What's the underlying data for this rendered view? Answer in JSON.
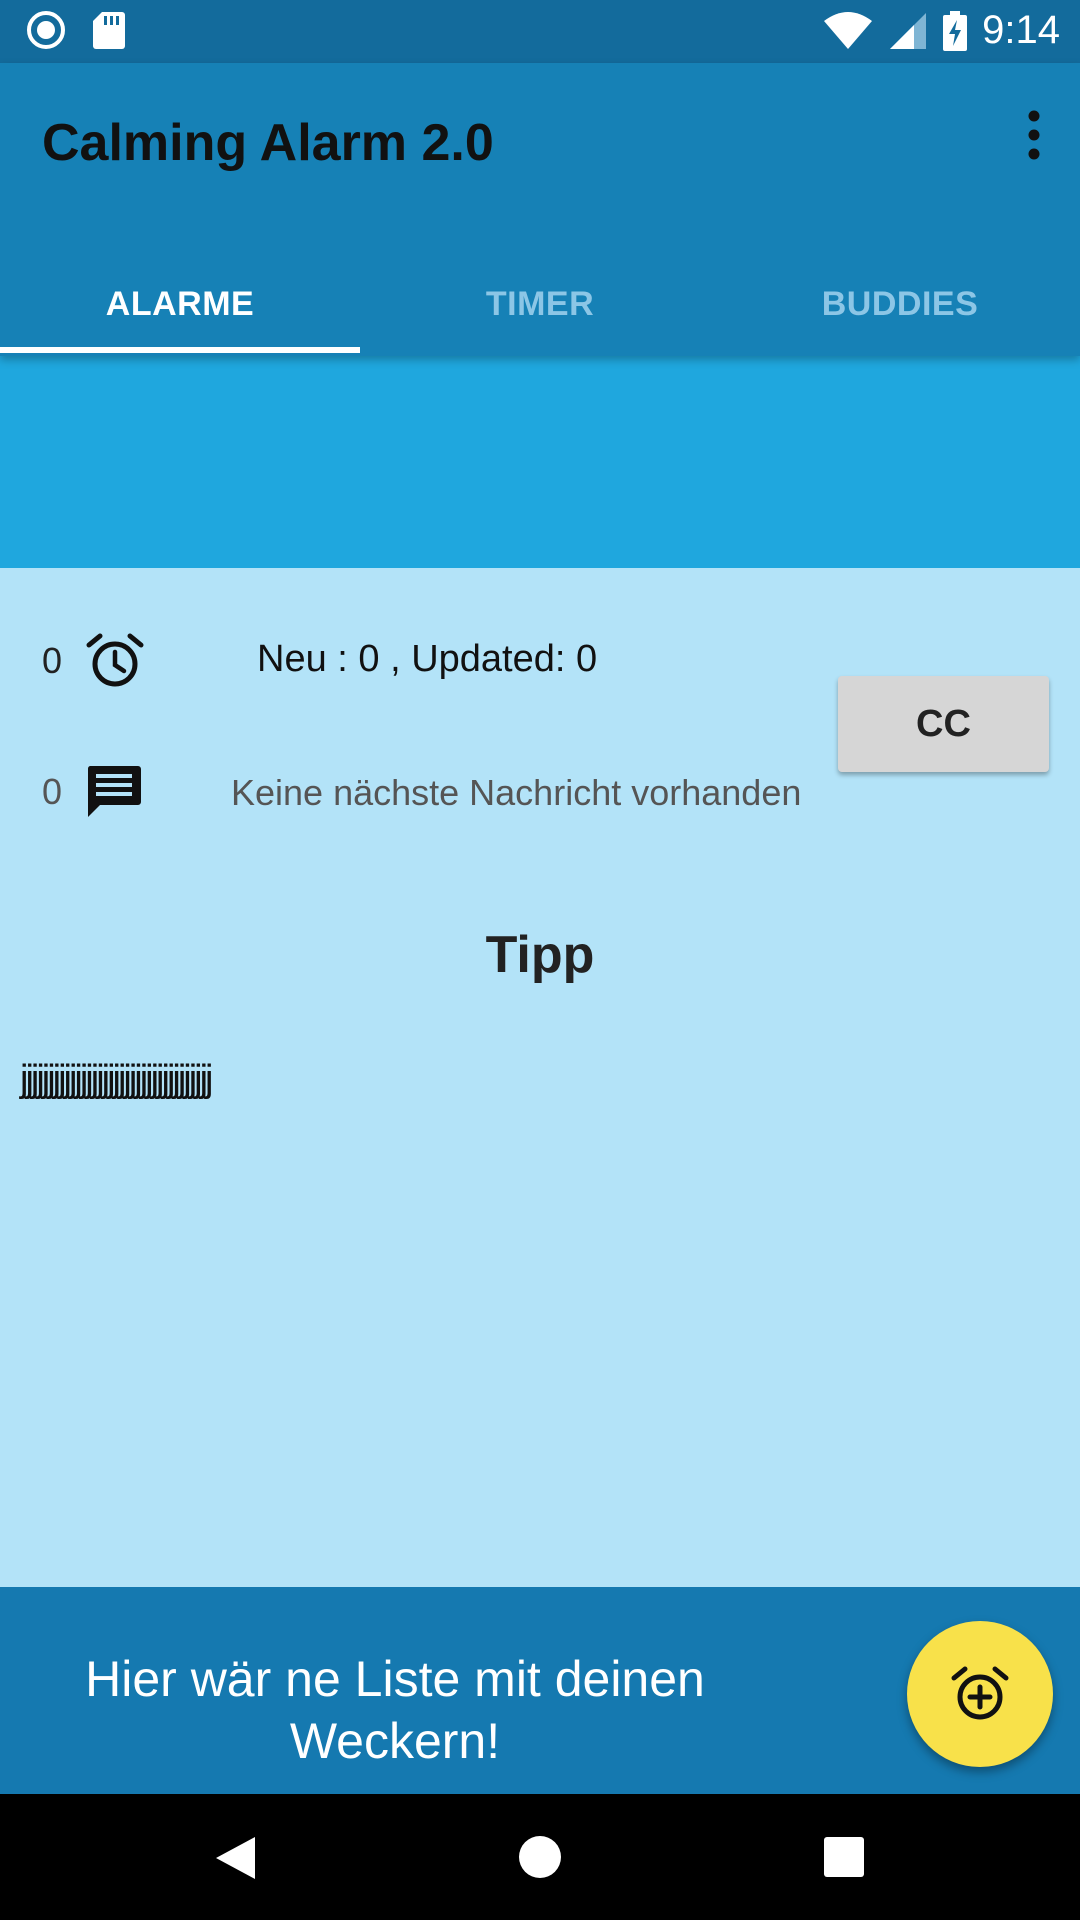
{
  "status_bar": {
    "time": "9:14",
    "left_icons": [
      "record-icon",
      "sd-card-icon"
    ],
    "right_icons": [
      "wifi-icon",
      "signal-icon",
      "battery-charging-icon"
    ]
  },
  "app_bar": {
    "title": "Calming Alarm 2.0",
    "menu_icon": "more-vert-icon",
    "tabs": [
      {
        "label": "ALARME",
        "active": true
      },
      {
        "label": "TIMER",
        "active": false
      },
      {
        "label": "BUDDIES",
        "active": false
      }
    ]
  },
  "colors": {
    "status_bar": "#136b9c",
    "app_bar": "#1681b6",
    "banner": "#1fa7de",
    "content_bg": "#b3e3f8",
    "fab": "#f8e14a"
  },
  "stats": {
    "alarm_count": "0",
    "alarm_icon": "alarm-clock-icon",
    "update_text": "Neu : 0 , Updated: 0",
    "message_count": "0",
    "message_icon": "message-icon",
    "message_text": "Keine nächste Nachricht vorhanden",
    "cc_label": "CC"
  },
  "tip": {
    "title": "Tipp",
    "text": "jjjjjjjjjjjjjjjjjjjjjjjjjjjjjjjjjjj"
  },
  "bottom": {
    "line1": "Hier wär ne Liste mit deinen",
    "line2": "Weckern!",
    "fab_icon": "add-alarm-icon"
  },
  "nav": {
    "buttons": [
      "back-icon",
      "home-icon",
      "recents-icon"
    ]
  }
}
